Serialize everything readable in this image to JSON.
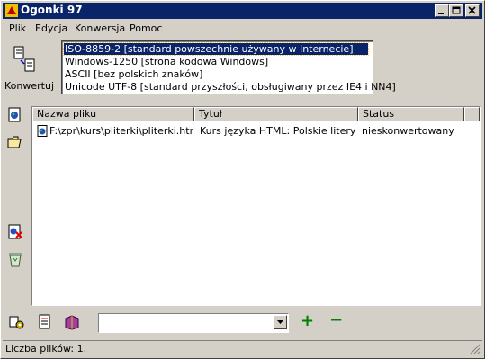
{
  "window": {
    "title": "Ogonki 97"
  },
  "menu": [
    "Plik",
    "Edycja",
    "Konwersja",
    "Pomoc"
  ],
  "convert": {
    "label": "Konwertuj"
  },
  "encodings": [
    "ISO-8859-2 [standard powszechnie używany w Internecie]",
    "Windows-1250 [strona kodowa Windows]",
    "ASCII [bez polskich znaków]",
    "Unicode UTF-8 [standard przyszłości, obsługiwany przez IE4 i NN4]"
  ],
  "selected_encoding_index": 0,
  "table": {
    "headers": [
      "Nazwa pliku",
      "Tytuł",
      "Status"
    ],
    "rows": [
      {
        "file": "F:\\zpr\\kurs\\pliterki\\pliterki.htm",
        "title": "Kurs języka HTML: Polskie litery i...",
        "status": "nieskonwertowany"
      }
    ]
  },
  "bottom_toolbar": {
    "add_symbol": "+",
    "remove_symbol": "−",
    "combo_value": ""
  },
  "status": {
    "text": "Liczba plików: 1."
  },
  "icons": [
    "app-icon",
    "convert-icon",
    "html-file-icon",
    "open-folder-icon",
    "remove-file-icon",
    "recycle-bin-icon",
    "settings-icon",
    "notepad-icon",
    "help-book-icon"
  ],
  "colors": {
    "titlebar": "#0a246a",
    "selection": "#0a246a",
    "face": "#d4d0c8",
    "add_green": "#008000"
  }
}
